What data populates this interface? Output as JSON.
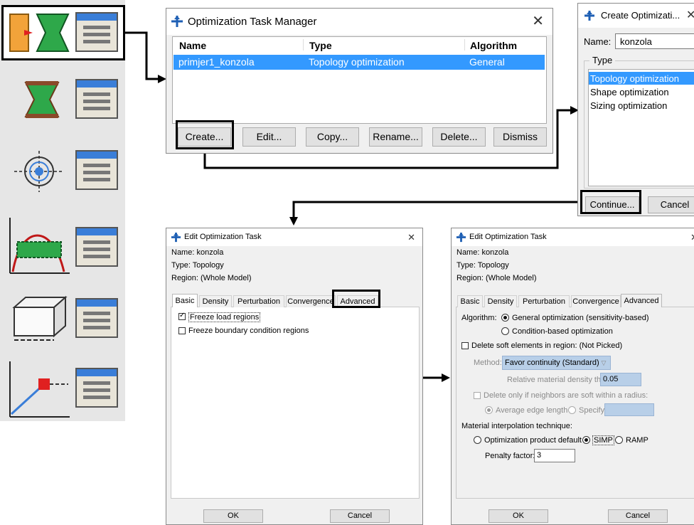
{
  "task_manager": {
    "title": "Optimization Task Manager",
    "columns": [
      "Name",
      "Type",
      "Algorithm"
    ],
    "row": {
      "name": "primjer1_konzola",
      "type": "Topology optimization",
      "algorithm": "General"
    },
    "buttons": {
      "create": "Create...",
      "edit": "Edit...",
      "copy": "Copy...",
      "rename": "Rename...",
      "delete": "Delete...",
      "dismiss": "Dismiss"
    }
  },
  "create_dialog": {
    "title": "Create Optimizati...",
    "name_label": "Name:",
    "name_value": "konzola",
    "group_label": "Type",
    "types": [
      "Topology optimization",
      "Shape optimization",
      "Sizing optimization"
    ],
    "continue": "Continue...",
    "cancel": "Cancel"
  },
  "edit_common": {
    "title": "Edit Optimization Task",
    "name": "Name:  konzola",
    "type": "Type:   Topology",
    "region": "Region:  (Whole Model)",
    "tabs": [
      "Basic",
      "Density",
      "Perturbation",
      "Convergence",
      "Advanced"
    ],
    "ok": "OK",
    "cancel": "Cancel"
  },
  "edit_basic": {
    "freeze_load": "Freeze load regions",
    "freeze_boundary": "Freeze boundary condition regions"
  },
  "edit_advanced": {
    "algorithm_label": "Algorithm:",
    "algo_general": "General optimization (sensitivity-based)",
    "algo_condition": "Condition-based optimization",
    "delete_soft": "Delete soft elements in region:  (Not Picked)",
    "method_label": "Method:",
    "method_value": "Favor continuity (Standard)",
    "threshold_label": "Relative material density threshold:",
    "threshold_value": "0.05",
    "delete_neighbors": "Delete only if neighbors are soft within a radius:",
    "avg_edge": "Average edge length",
    "specify": "Specify:",
    "interp_label": "Material interpolation technique:",
    "interp_default": "Optimization product default",
    "interp_simp": "SIMP",
    "interp_ramp": "RAMP",
    "penalty_label": "Penalty factor:",
    "penalty_value": "3"
  },
  "colors": {
    "selection": "#3399ff",
    "dialog_bg": "#f0f0f0",
    "highlight": "#000000",
    "tab_line": "#f0f0f0"
  }
}
